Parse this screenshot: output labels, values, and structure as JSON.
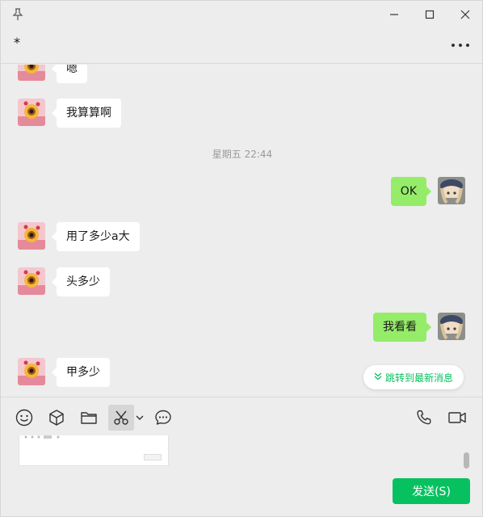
{
  "window": {
    "title_symbol": "*"
  },
  "messages": [
    {
      "side": "in",
      "text": "嗯"
    },
    {
      "side": "in",
      "text": "我算算啊"
    },
    {
      "side": "out",
      "text": "OK"
    },
    {
      "side": "in",
      "text": "用了多少a大"
    },
    {
      "side": "in",
      "text": "头多少"
    },
    {
      "side": "out",
      "text": "我看看"
    },
    {
      "side": "in",
      "text": "甲多少"
    }
  ],
  "timestamp": "星期五 22:44",
  "jump_button": {
    "label": "跳转到最新消息",
    "icon": "double-chevron-down-icon"
  },
  "toolbar": {
    "tools": [
      "emoji-icon",
      "cube-icon",
      "folder-icon",
      "scissors-icon",
      "chevron-down-icon",
      "chat-bubble-icon",
      "phone-icon",
      "video-icon"
    ]
  },
  "send_button": {
    "label": "发送(S)"
  },
  "colors": {
    "accent": "#07c160",
    "bubble_out": "#95ec69",
    "bubble_in": "#ffffff",
    "background": "#ededed"
  }
}
